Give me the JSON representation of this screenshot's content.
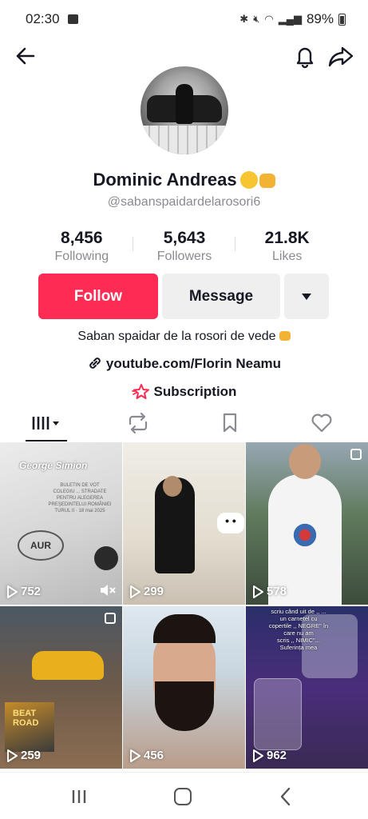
{
  "status_bar": {
    "time": "02:30",
    "battery": "89%"
  },
  "profile": {
    "name": "Dominic Andreas",
    "handle": "@sabanspaidardelarosori6",
    "stats": [
      {
        "value": "8,456",
        "label": "Following"
      },
      {
        "value": "5,643",
        "label": "Followers"
      },
      {
        "value": "21.8K",
        "label": "Likes"
      }
    ],
    "buttons": {
      "follow": "Follow",
      "message": "Message"
    },
    "bio": "Saban spaidar de la rosori de vede",
    "link": "youtube.com/Florin Neamu",
    "subscription": "Subscription"
  },
  "tabs": [
    "videos-tab",
    "reposts-tab",
    "favorites-tab",
    "liked-tab"
  ],
  "videos": [
    {
      "views": "752",
      "overlay_title": "George Simion",
      "ballot_text": "BULETIN DE VOT\nCOLEGIU ... STRADATE\nPENTRU ALEGEREA PREŞEDINTELUI ROMÂNIEI\nTURUL II · 18 mai 2025",
      "stamp": "AUR",
      "multi": false
    },
    {
      "views": "299",
      "multi": false
    },
    {
      "views": "578",
      "multi": true
    },
    {
      "views": "259",
      "album_text": "BEAT ROAD",
      "multi": true
    },
    {
      "views": "456",
      "multi": false
    },
    {
      "views": "962",
      "overlay_text": "scriu când uit de ,, ...\nun carnețel cu\ncopertile ,, NEGRE\" în\ncare nu am\nscris ,, NIMIC\"...\nSuferința mea",
      "multi": false
    }
  ],
  "colors": {
    "accent": "#fe2c55",
    "secondary_button": "#efefef",
    "text": "#161823",
    "muted": "#8a8b91"
  }
}
